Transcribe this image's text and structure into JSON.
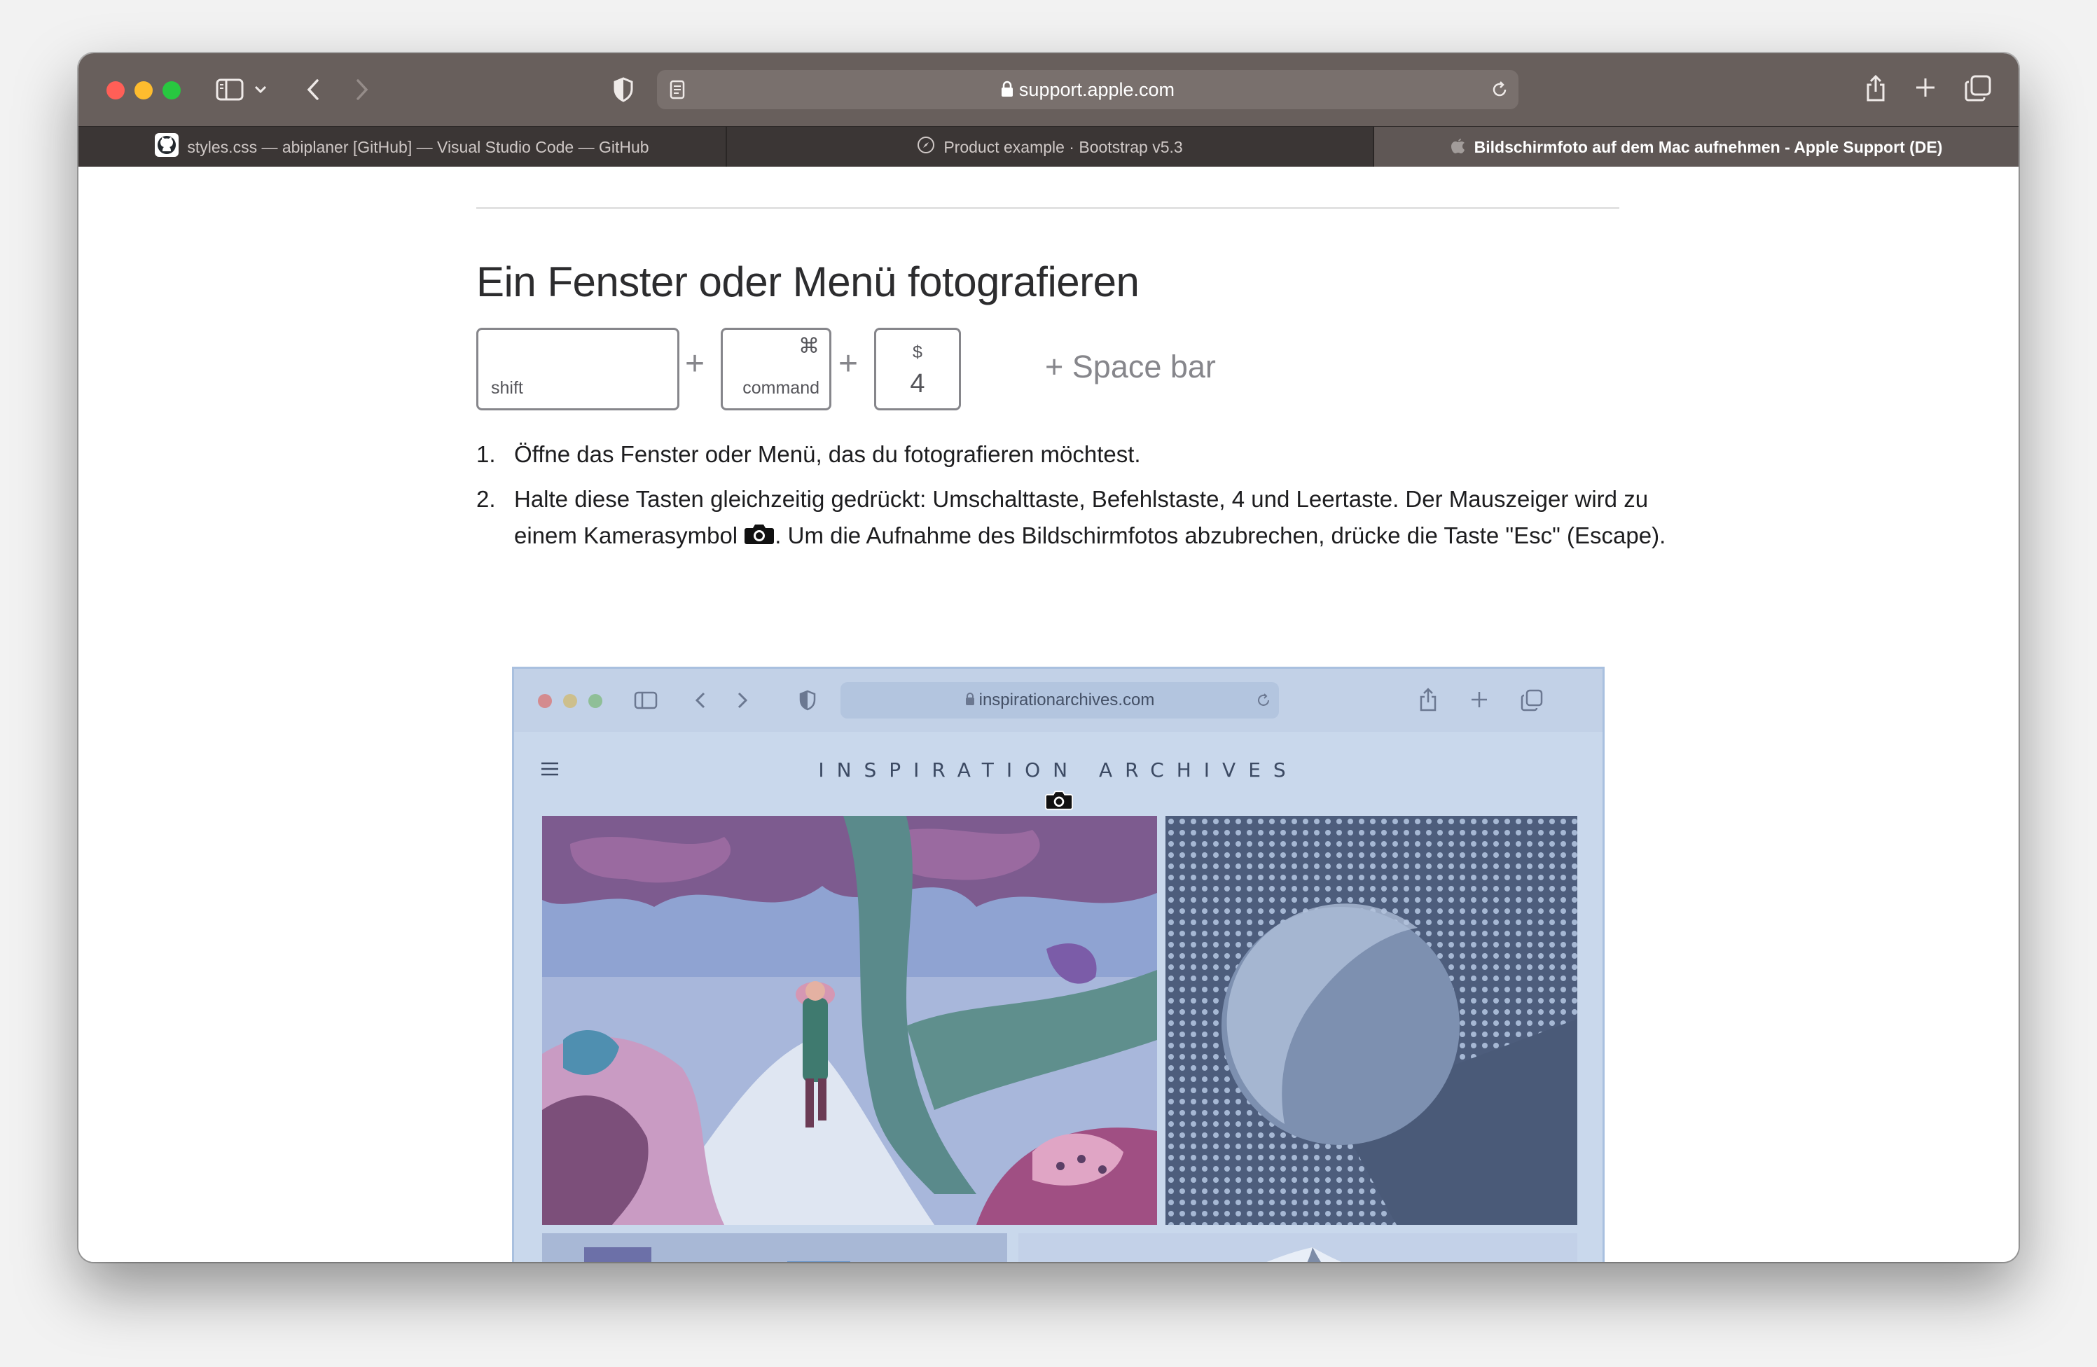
{
  "browser": {
    "url": "support.apple.com",
    "tabs": [
      {
        "label": "styles.css — abiplaner [GitHub] — Visual Studio Code — GitHub",
        "icon": "github-icon",
        "active": false
      },
      {
        "label": "Product example · Bootstrap v5.3",
        "icon": "compass-icon",
        "active": false
      },
      {
        "label": "Bildschirmfoto auf dem Mac aufnehmen - Apple Support (DE)",
        "icon": "apple-icon",
        "active": true
      }
    ]
  },
  "article": {
    "heading": "Ein Fenster oder Menü fotografieren",
    "keys": {
      "shift_label": "shift",
      "command_symbol": "⌘",
      "command_label": "command",
      "four_symbol": "$",
      "four_label": "4",
      "plus": "+",
      "space_bar": "+ Space bar"
    },
    "steps": [
      {
        "num": "1.",
        "text": "Öffne das Fenster oder Menü, das du fotografieren möchtest."
      },
      {
        "num": "2.",
        "text_before": "Halte diese Tasten gleichzeitig gedrückt: Umschalttaste, Befehlstaste, 4 und Leertaste. Der Mauszeiger wird zu einem Kamerasymbol",
        "text_after": ". Um die Aufnahme des Bildschirmfotos abzubrechen, drücke die Taste \"Esc\" (Escape)."
      }
    ],
    "screenshot": {
      "url": "inspirationarchives.com",
      "site_title": "INSPIRATION ARCHIVES"
    }
  },
  "colors": {
    "toolbar": "#685f5c",
    "tabbar": "#3b3635",
    "active_tab": "#5f5755",
    "highlight_overlay": "#a9c0df"
  }
}
